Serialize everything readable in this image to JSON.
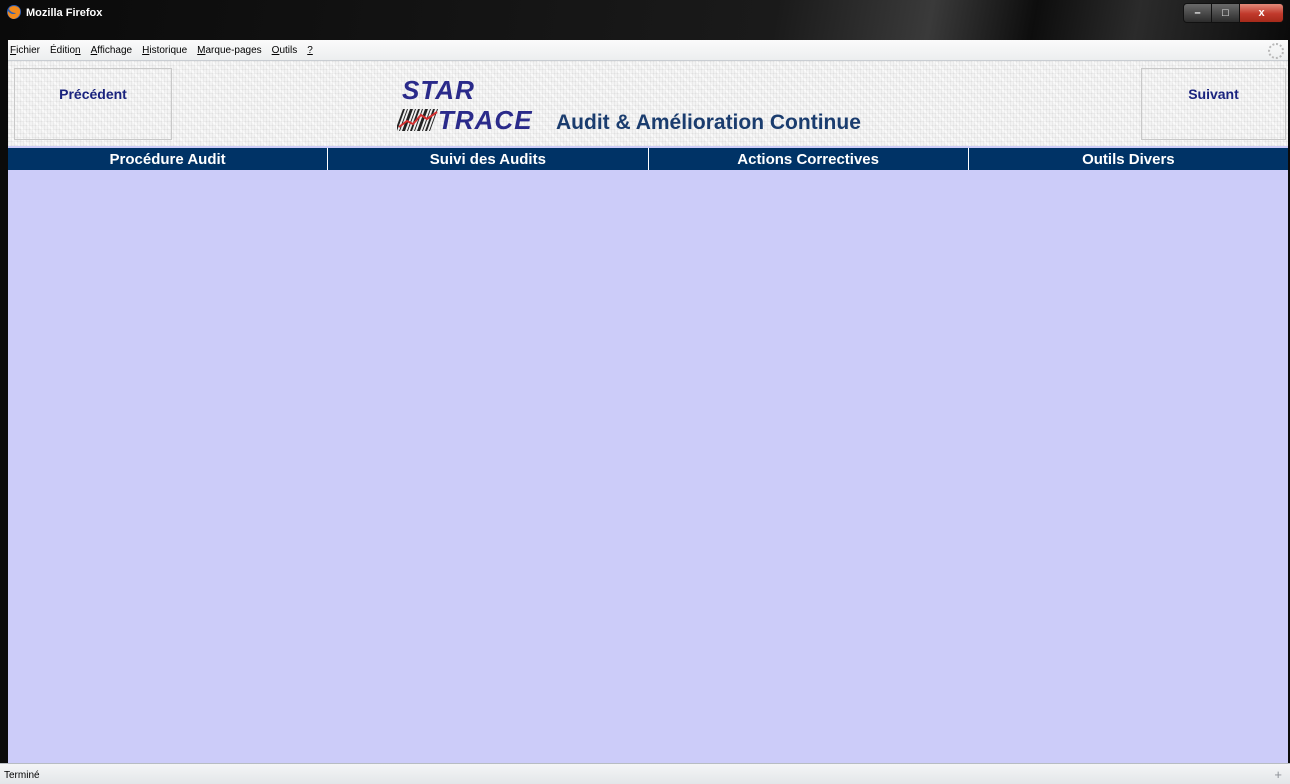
{
  "window": {
    "title": "Mozilla Firefox",
    "controls": {
      "minimize": "–",
      "maximize": "□",
      "close": "x"
    }
  },
  "menubar": {
    "items": [
      {
        "key": "F",
        "rest": "ichier"
      },
      {
        "key": "",
        "pre": "Éditio",
        "rest": "",
        "post_key": "n"
      },
      {
        "key": "A",
        "rest": "ffichage"
      },
      {
        "key": "H",
        "rest": "istorique"
      },
      {
        "key": "M",
        "rest": "arque-pages"
      },
      {
        "key": "O",
        "rest": "utils"
      },
      {
        "key": "?",
        "rest": ""
      }
    ]
  },
  "banner": {
    "prev_label": "Précédent",
    "next_label": "Suivant",
    "logo_star": "STAR",
    "logo_trace": "TRACE",
    "title": "Audit & Amélioration Continue"
  },
  "tabs": [
    {
      "label": "Procédure Audit"
    },
    {
      "label": "Suivi des Audits"
    },
    {
      "label": "Actions Correctives"
    },
    {
      "label": "Outils Divers"
    }
  ],
  "colors": {
    "content_bg": "#ccccf9",
    "tab_bar": "#003366",
    "nav_text": "#1a237e",
    "title_text": "#1a3c6e"
  },
  "statusbar": {
    "text": "Terminé"
  }
}
